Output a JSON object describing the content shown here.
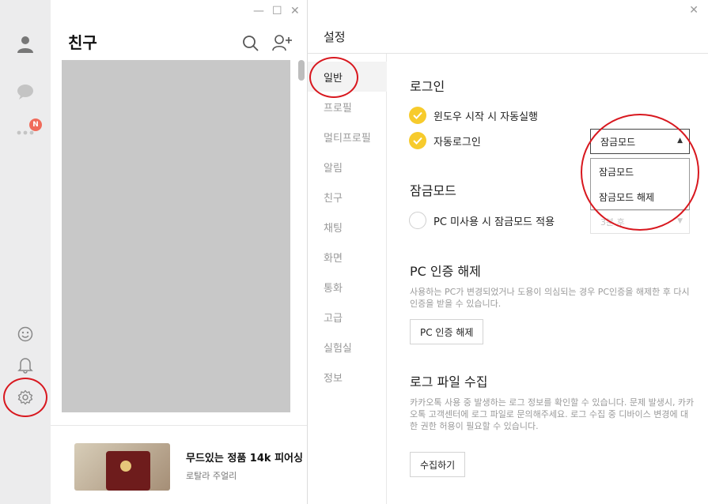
{
  "rail": {
    "badge": "N",
    "icons": [
      "person-icon",
      "chat-bubble-icon",
      "more-icon",
      "emoji-icon",
      "bell-icon",
      "gear-icon"
    ]
  },
  "friends": {
    "title": "친구",
    "window_controls": [
      "—",
      "☐",
      "✕"
    ],
    "ad": {
      "title": "무드있는 정품 14k 피어싱",
      "subtitle": "로탈라 주얼리"
    }
  },
  "settings": {
    "title": "설정",
    "close": "✕",
    "nav": [
      "일반",
      "프로필",
      "멀티프로필",
      "알림",
      "친구",
      "채팅",
      "화면",
      "통화",
      "고급",
      "실험실",
      "정보"
    ],
    "login": {
      "heading": "로그인",
      "autostart": "윈도우 시작 시 자동실행",
      "autologin": "자동로그인",
      "select_value": "잠금모드",
      "options": [
        "잠금모드",
        "잠금모드 해제"
      ]
    },
    "lock": {
      "heading": "잠금모드",
      "option": "PC 미사용 시 잠금모드 적용",
      "select_value": "3분 후"
    },
    "pc_auth": {
      "heading": "PC 인증 해제",
      "desc": "사용하는 PC가 변경되었거나 도용이 의심되는 경우 PC인증을 해제한 후 다시 인증을 받을 수 있습니다.",
      "button": "PC 인증 해제"
    },
    "log": {
      "heading": "로그 파일 수집",
      "desc": "카카오톡 사용 중 발생하는 로그 정보를 확인할 수 있습니다. 문제 발생시, 카카오톡 고객센터에 로그 파일로 문의해주세요. 로그 수집 중 디바이스 변경에 대한 권한 허용이 필요할 수 있습니다.",
      "button": "수집하기"
    }
  },
  "colors": {
    "accent": "#f7cb2c",
    "annotation": "#d8181f",
    "badge": "#f06b5b"
  }
}
